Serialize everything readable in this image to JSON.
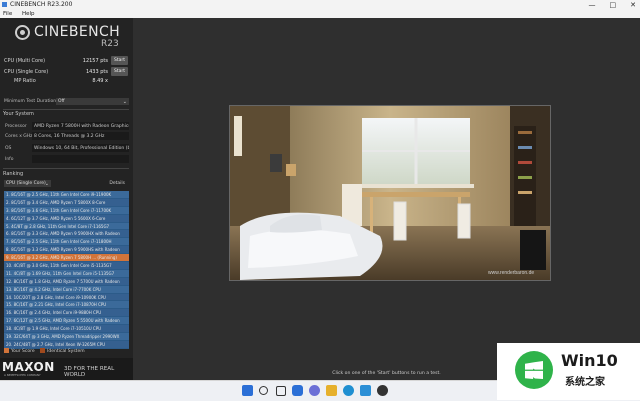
{
  "window": {
    "title": "CINEBENCH R23.200",
    "controls": [
      "—",
      "□",
      "✕"
    ]
  },
  "menu": [
    "File",
    "Help"
  ],
  "logo": {
    "brand": "CINEBENCH",
    "version": "R23"
  },
  "benchmarks": [
    {
      "label": "CPU (Multi Core)",
      "score": "12157 pts",
      "button": "Start"
    },
    {
      "label": "CPU (Single Core)",
      "score": "1433 pts",
      "button": "Start"
    },
    {
      "label": "MP Ratio",
      "score": "8.49 x"
    }
  ],
  "min_duration": {
    "label": "Minimum Test Duration",
    "value": "Off"
  },
  "system": {
    "title": "Your System",
    "fields": [
      {
        "k": "Processor",
        "v": "AMD Ryzen 7 5800H with Radeon Graphics"
      },
      {
        "k": "Cores x GHz",
        "v": "8 Cores, 16 Threads @ 3.2 GHz"
      },
      {
        "k": "OS",
        "v": "Windows 10, 64 Bit, Professional Edition (build 2"
      },
      {
        "k": "Info",
        "v": ""
      }
    ]
  },
  "ranking": {
    "title": "Ranking",
    "mode": "CPU (Single Core)",
    "details": "Details",
    "items": [
      "1. 8C/16T @ 2.5 GHz, 11th Gen Intel Core i9-11900K",
      "2. 8C/16T @ 3.4 GHz, AMD Ryzen 7 5800X 8-Core",
      "3. 8C/16T @ 3.6 GHz, 11th Gen Intel Core i7-11700K",
      "4. 6C/12T @ 3.7 GHz, AMD Ryzen 5 5600X 6-Core",
      "5. 4C/8T @ 2.8 GHz, 11th Gen Intel Core i7-1165G7",
      "6. 8C/16T @ 3.3 GHz, AMD Ryzen 9 5900HX with Radeon",
      "7. 8C/16T @ 2.5 GHz, 11th Gen Intel Core i7-11800H",
      "8. 8C/16T @ 3.3 GHz, AMD Ryzen 9 5900HS with Radeon",
      "9. 8C/16T @ 3.2 GHz, AMD Ryzen 7 5800H ... (Running)",
      "10. 4C/8T @ 3.0 GHz, 11th Gen Intel Core i5-1135G7",
      "11. 4C/8T @ 1.69 GHz, 11th Gen Intel Core i5-1135G7",
      "12. 8C/16T @ 1.8 GHz, AMD Ryzen 7 5700U with Radeon",
      "13. 8C/16T @ 4.2 GHz, Intel Core i7-7700K CPU",
      "14. 10C/20T @ 2.8 GHz, Intel Core i9-10900K CPU",
      "15. 8C/16T @ 2.21 GHz, Intel Core i7-10870H CPU",
      "16. 8C/16T @ 2.4 GHz, Intel Core i9-9880H CPU",
      "17. 6C/12T @ 2.5 GHz, AMD Ryzen 5 5500U with Radeon",
      "18. 4C/8T @ 1.9 GHz, Intel Core i7-10510U CPU",
      "19. 32C/64T @ 3 GHz, AMD Ryzen Threadripper 2990WX",
      "20. 24C/48T @ 2.7 GHz, Intel Xeon W-3265M CPU"
    ],
    "mine_index": 8,
    "legend_yours": "Your Score",
    "legend_identical": "Identical System"
  },
  "footer": {
    "brand": "MAXON",
    "sub": "A NEMETSCHEK COMPANY",
    "tagline": "3D FOR THE REAL WORLD"
  },
  "status_text": "Click on one of the 'Start' buttons to run a test.",
  "watermark": "www.renderbaron.de",
  "badge": {
    "brand": "Win10",
    "sub": "系统之家"
  },
  "taskbar_icons": [
    "start-icon",
    "search-icon",
    "task-view-icon",
    "widgets-icon",
    "chat-icon",
    "file-explorer-icon",
    "edge-icon",
    "store-icon",
    "cinebench-icon"
  ],
  "colors": {
    "accent": "#3b6a9a",
    "mine": "#d2743a",
    "identical": "#a04a1e"
  }
}
